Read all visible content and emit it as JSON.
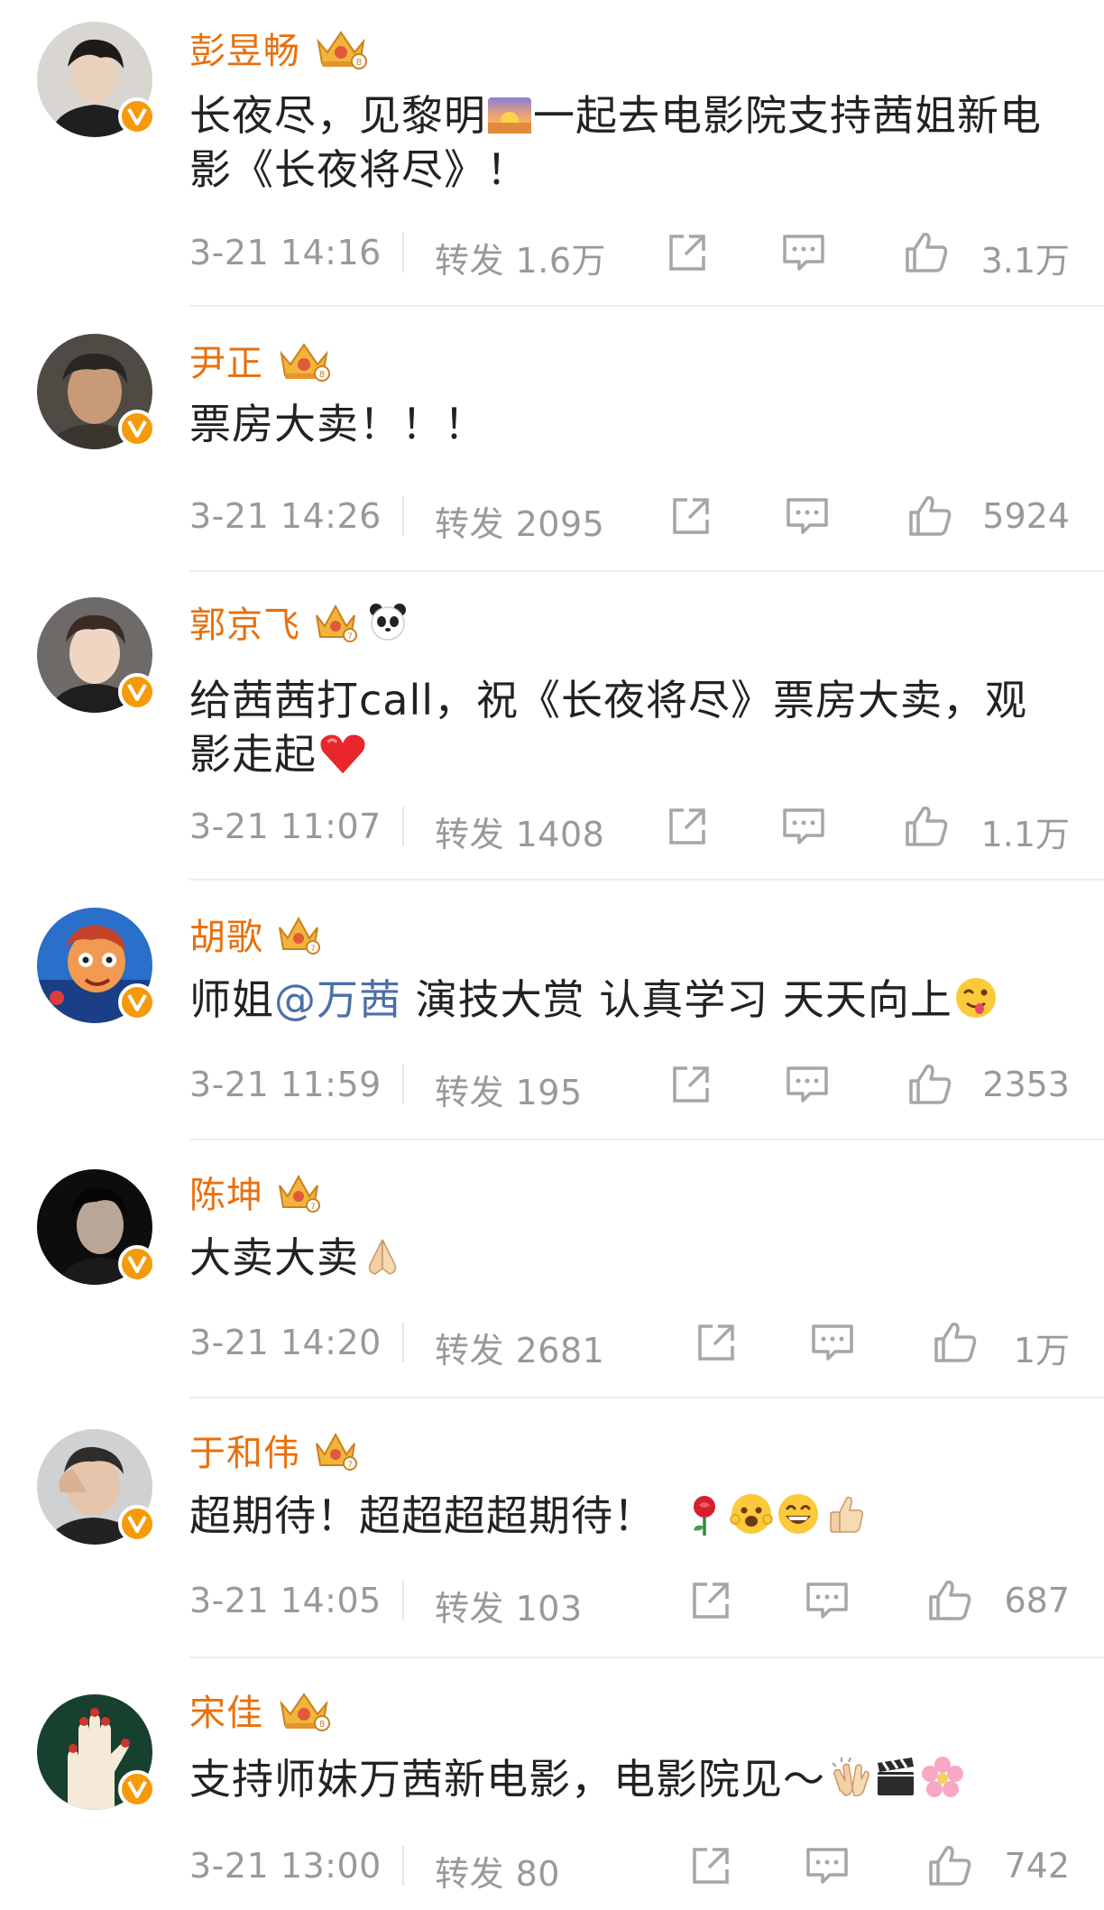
{
  "comments": [
    {
      "name": "彭昱畅",
      "text_parts": [
        "长夜尽，见黎明",
        "一起去电影院支持茜姐新电影《长夜将尽》！"
      ],
      "time": "3-21 14:16",
      "forward_label": "转发",
      "forward_count": "1.6万",
      "likes": "3.1万",
      "emoji": [
        "sunrise-emoji"
      ]
    },
    {
      "name": "尹正",
      "text": "票房大卖！！！",
      "time": "3-21 14:26",
      "forward_label": "转发",
      "forward_count": "2095",
      "likes": "5924"
    },
    {
      "name": "郭京飞",
      "text": "给茜茜打call，祝《长夜将尽》票房大卖，观影走起",
      "time": "3-21 11:07",
      "forward_label": "转发",
      "forward_count": "1408",
      "likes": "1.1万",
      "emoji": [
        "red-heart-emoji",
        "panda-badge-icon"
      ]
    },
    {
      "name": "胡歌",
      "text_before": "师姐",
      "mention": "@万茜",
      "text_after": " 演技大赏 认真学习 天天向上",
      "time": "3-21 11:59",
      "forward_label": "转发",
      "forward_count": "195",
      "likes": "2353",
      "emoji": [
        "winking-tongue-emoji"
      ]
    },
    {
      "name": "陈坤",
      "text": "大卖大卖",
      "time": "3-21 14:20",
      "forward_label": "转发",
      "forward_count": "2681",
      "likes": "1万",
      "emoji": [
        "folded-hands-emoji"
      ]
    },
    {
      "name": "于和伟",
      "text": "超期待！超超超超期待！",
      "time": "3-21 14:05",
      "forward_label": "转发",
      "forward_count": "103",
      "likes": "687",
      "emoji": [
        "rose-emoji",
        "excited-emoji",
        "grinning-emoji",
        "thumbs-up-emoji"
      ]
    },
    {
      "name": "宋佳",
      "text": "支持师妹万茜新电影，电影院见～",
      "time": "3-21 13:00",
      "forward_label": "转发",
      "forward_count": "80",
      "likes": "742",
      "emoji": [
        "clapping-hands-emoji",
        "clapper-board-emoji",
        "cherry-blossom-emoji"
      ]
    }
  ],
  "colors": {
    "name": "#e8700e",
    "text": "#222222",
    "meta": "#999999",
    "mention": "#4d6fa8",
    "verified_badge": "#f59b0b"
  },
  "icons": [
    "crown-level-icon",
    "verified-v-icon",
    "share-icon",
    "comment-icon",
    "like-icon"
  ]
}
